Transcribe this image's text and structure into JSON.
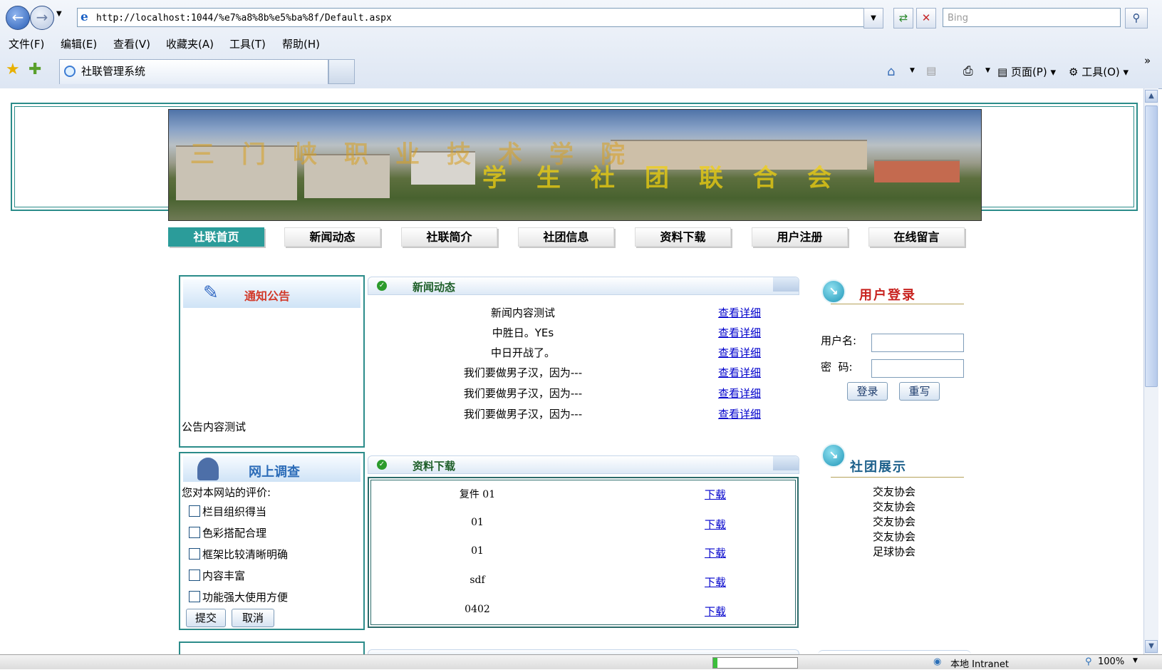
{
  "browser": {
    "address": "http://localhost:1044/%e7%a8%8b%e5%ba%8f/Default.aspx",
    "search_placeholder": "Bing",
    "menus": [
      "文件(F)",
      "编辑(E)",
      "查看(V)",
      "收藏夹(A)",
      "工具(T)",
      "帮助(H)"
    ],
    "tab_title": "社联管理系统",
    "tools": {
      "page": "页面(P)",
      "tools": "工具(O)"
    },
    "status": {
      "zone": "本地 Intranet",
      "zoom": "100%"
    }
  },
  "banner": {
    "line1": "三门峡职业技术学院",
    "line2": "学生社团联合会"
  },
  "nav": [
    "社联首页",
    "新闻动态",
    "社联简介",
    "社团信息",
    "资料下载",
    "用户注册",
    "在线留言"
  ],
  "notice": {
    "title": "通知公告",
    "content": "公告内容测试"
  },
  "survey": {
    "title": "网上调查",
    "question": "您对本网站的评价:",
    "options": [
      "栏目组织得当",
      "色彩搭配合理",
      "框架比较清晰明确",
      "内容丰富",
      "功能强大使用方便"
    ],
    "submit": "提交",
    "cancel": "取消"
  },
  "news": {
    "title": "新闻动态",
    "items": [
      {
        "text": "新闻内容测试",
        "link": "查看详细"
      },
      {
        "text": "中胜日。YEs",
        "link": "查看详细"
      },
      {
        "text": "中日开战了。",
        "link": "查看详细"
      },
      {
        "text": "我们要做男子汉，因为---",
        "link": "查看详细"
      },
      {
        "text": "我们要做男子汉，因为---",
        "link": "查看详细"
      },
      {
        "text": "我们要做男子汉，因为---",
        "link": "查看详细"
      }
    ]
  },
  "downloads": {
    "title": "资料下载",
    "items": [
      {
        "name": "复件 01",
        "link": "下载"
      },
      {
        "name": "01",
        "link": "下载"
      },
      {
        "name": "01",
        "link": "下载"
      },
      {
        "name": "sdf",
        "link": "下载"
      },
      {
        "name": "0402",
        "link": "下载"
      }
    ]
  },
  "login": {
    "title": "用户登录",
    "username_label": "用户名:",
    "password_label": "密  码:",
    "login_btn": "登录",
    "reset_btn": "重写"
  },
  "clubs": {
    "title": "社团展示",
    "items": [
      "交友协会",
      "交友协会",
      "交友协会",
      "交友协会",
      "足球协会"
    ]
  }
}
